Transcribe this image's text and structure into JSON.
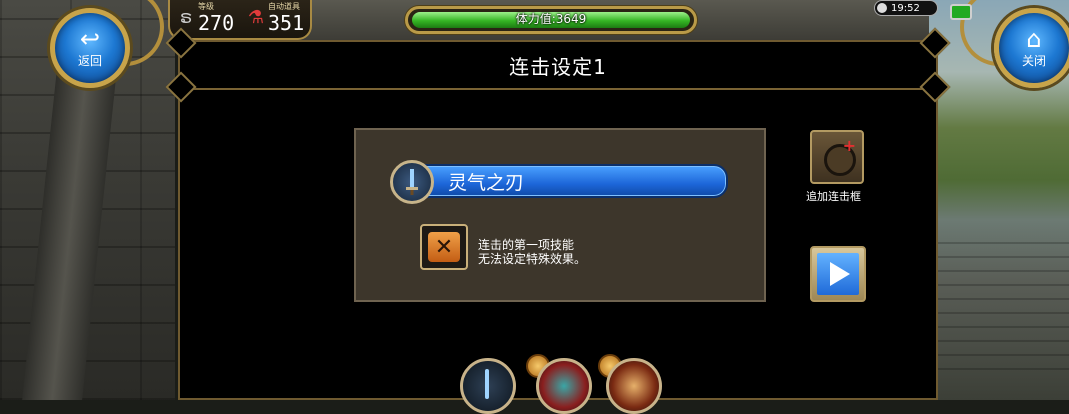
{
  "hud": {
    "back_label": "返回",
    "close_label": "关闭",
    "level": {
      "caption": "等级",
      "value": "270"
    },
    "auto_items": {
      "caption": "自动道具",
      "value": "351"
    },
    "stamina": {
      "text": "体力值:3649",
      "fill_fraction": 1.0,
      "color": "#35b524"
    },
    "clock": "19:52"
  },
  "dialog": {
    "title": "连击设定1",
    "skill_name": "灵气之刃",
    "note_line1": "连击的第一项技能",
    "note_line2": "无法设定特殊效果。",
    "add_combo_label": "追加连击框"
  },
  "colors": {
    "accent_gold": "#c8a44a",
    "skill_blue": "#1d66d9",
    "panel_brown": "#3d362b"
  },
  "icons": {
    "back": "return-arrow-icon",
    "close": "home-icon",
    "level": "level-swirl-icon",
    "potion": "potion-flask-icon",
    "sword": "sword-icon",
    "cancel": "x-icon",
    "add": "add-combo-icon",
    "play": "play-icon"
  }
}
